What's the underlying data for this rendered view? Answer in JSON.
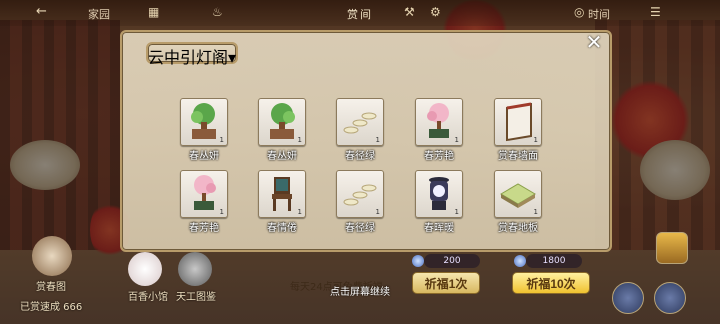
{
  "top_bar": {
    "back_glyph": "←",
    "home_label": "家园",
    "title": "赏间",
    "time_label": "时间"
  },
  "category_tab": "云中引灯阁▾",
  "items": [
    {
      "label": "春丛妍",
      "qty": "1",
      "icon": "tree-green-icon"
    },
    {
      "label": "春丛妍",
      "qty": "1",
      "icon": "tree-green-icon"
    },
    {
      "label": "春径绿",
      "qty": "1",
      "icon": "stepping-stones-icon"
    },
    {
      "label": "春芳艳",
      "qty": "1",
      "icon": "pink-blossom-tree-icon"
    },
    {
      "label": "赏春墙面",
      "qty": "1",
      "icon": "wall-panel-icon"
    },
    {
      "label": "春芳艳",
      "qty": "1",
      "icon": "pink-blossom-tree-icon"
    },
    {
      "label": "春情倦",
      "qty": "1",
      "icon": "wooden-chair-icon"
    },
    {
      "label": "春径绿",
      "qty": "1",
      "icon": "stepping-stones-icon"
    },
    {
      "label": "春晖暖",
      "qty": "1",
      "icon": "lantern-icon"
    },
    {
      "label": "赏春地板",
      "qty": "1",
      "icon": "grass-floor-icon"
    }
  ],
  "bottom": {
    "left_avatar_label": "赏春图",
    "left_footer": "已赏速成 666",
    "mini_program_label": "百香小馆",
    "daily_label": "天工图鉴",
    "daily_note": "每天24点可免费祈福",
    "price_single": "200",
    "price_ten": "1800",
    "pray_single": "祈福1次",
    "pray_ten": "祈福10次",
    "continue_hint": "点击屏幕继续"
  },
  "colors": {
    "panel_bg": "#e2d6be",
    "pray_gold": "#f0c230",
    "label_text": "#ffffff"
  }
}
